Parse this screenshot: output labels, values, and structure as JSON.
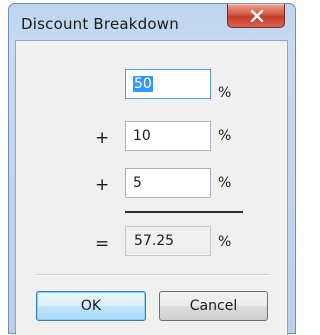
{
  "window": {
    "title": "Discount Breakdown"
  },
  "fields": {
    "first": {
      "value": "50",
      "unit": "%"
    },
    "second": {
      "operator": "+",
      "value": "10",
      "unit": "%"
    },
    "third": {
      "operator": "+",
      "value": "5",
      "unit": "%"
    }
  },
  "result": {
    "operator": "=",
    "value": "57.25",
    "unit": "%"
  },
  "buttons": {
    "ok": "OK",
    "cancel": "Cancel"
  },
  "icons": {
    "close": "close-icon"
  },
  "colors": {
    "selection": "#3399ff",
    "close_button": "#c9452f",
    "default_button_border": "#3c7fb1"
  }
}
